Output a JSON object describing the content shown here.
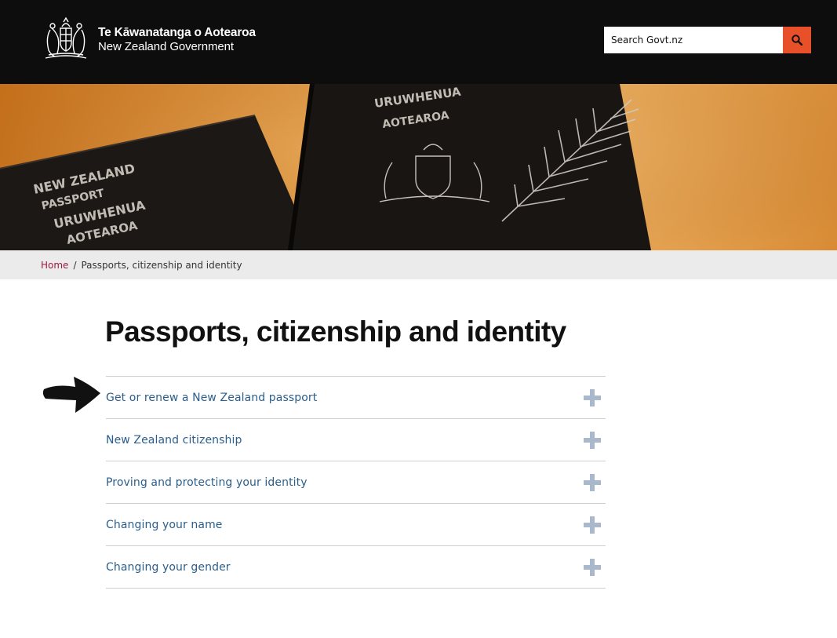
{
  "header": {
    "logo_line1": "Te Kāwanatanga o Aotearoa",
    "logo_line2": "New Zealand Government",
    "logo_icon": "nz-coat-of-arms",
    "search": {
      "placeholder": "Search Govt.nz",
      "button_icon": "search-icon"
    }
  },
  "hero": {
    "image": "new-zealand-passports-photo",
    "passport_left_text": [
      "NEW ZEALAND",
      "PASSPORT",
      "URUWHENUA",
      "AOTEAROA"
    ],
    "passport_right_text": [
      "URUWHENUA",
      "AOTEAROA"
    ]
  },
  "breadcrumb": {
    "home": "Home",
    "separator": "/",
    "current": "Passports, citizenship and identity"
  },
  "main": {
    "title": "Passports, citizenship and identity",
    "accordion": [
      {
        "label": "Get or renew a New Zealand passport",
        "icon": "plus-icon"
      },
      {
        "label": "New Zealand citizenship",
        "icon": "plus-icon"
      },
      {
        "label": "Proving and protecting your identity",
        "icon": "plus-icon"
      },
      {
        "label": "Changing your name",
        "icon": "plus-icon"
      },
      {
        "label": "Changing your gender",
        "icon": "plus-icon"
      }
    ],
    "pointer_icon": "arrow-right-icon"
  },
  "colors": {
    "header_bg": "#0d0d0d",
    "search_button": "#e8502a",
    "breadcrumb_link": "#9b1b3f",
    "accordion_link": "#2a5e8c",
    "plus_icon": "#a9b8cb"
  }
}
